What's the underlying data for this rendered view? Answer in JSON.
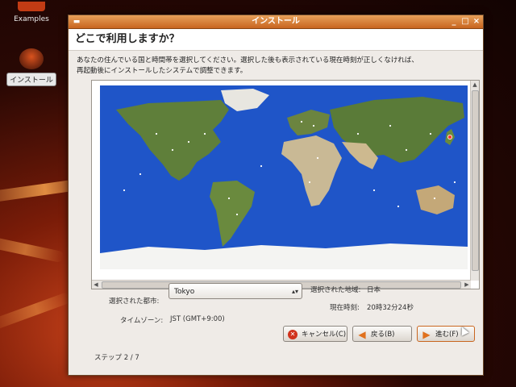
{
  "desktop": {
    "examples_label": "Examples",
    "install_label": "インストール"
  },
  "window": {
    "title": "インストール",
    "menu_icon": "window-menu-icon",
    "controls": [
      "minimize-icon",
      "maximize-icon",
      "close-icon"
    ]
  },
  "header": {
    "title": "どこで利用しますか？"
  },
  "description": {
    "line1": "あなたの住んでいる国と時間帯を選択してください。選択した後も表示されている現在時刻が正しくなければ、",
    "line2": "再起動後にインストールしたシステムで調整できます。"
  },
  "form": {
    "city_label": "選択された都市:",
    "city_value": "Tokyo",
    "region_label": "選択された地域:",
    "region_value": "日本",
    "timezone_label": "タイムゾーン:",
    "timezone_value": "JST (GMT+9:00)",
    "current_time_label": "現在時刻:",
    "current_time_value": "20時32分24秒"
  },
  "buttons": {
    "cancel": "キャンセル(C)",
    "back": "戻る(B)",
    "next": "進む(F)"
  },
  "footer": {
    "step": "ステップ 2 / 7"
  },
  "colors": {
    "title_bar": "#d9782e",
    "ocean": "#1f55c8",
    "land": "#5f7f3a",
    "window_bg": "#efebe7"
  }
}
